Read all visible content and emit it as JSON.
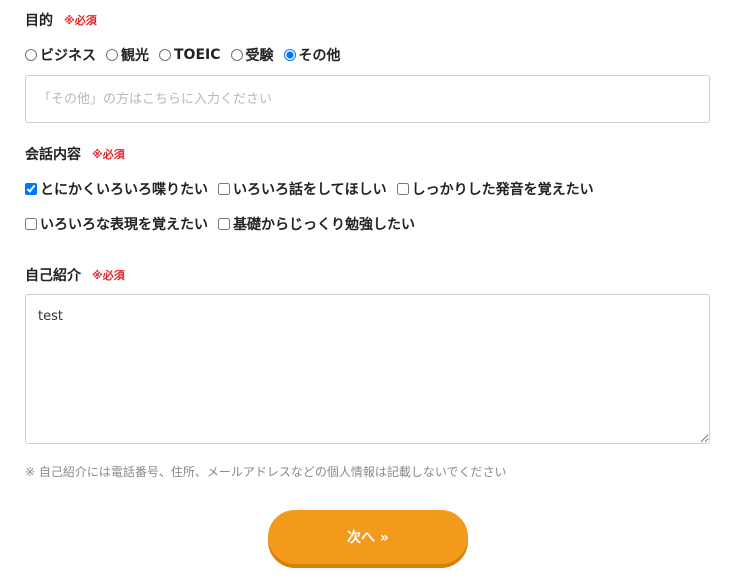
{
  "purpose": {
    "label": "目的",
    "required": "※必須",
    "options": [
      "ビジネス",
      "観光",
      "TOEIC",
      "受験",
      "その他"
    ],
    "selected": "その他",
    "other_placeholder": "「その他」の方はこちらに入力ください"
  },
  "conversation": {
    "label": "会話内容",
    "required": "※必須",
    "options": [
      {
        "label": "とにかくいろいろ喋りたい",
        "checked": true
      },
      {
        "label": "いろいろ話をしてほしい",
        "checked": false
      },
      {
        "label": "しっかりした発音を覚えたい",
        "checked": false
      },
      {
        "label": "いろいろな表現を覚えたい",
        "checked": false
      },
      {
        "label": "基礎からじっくり勉強したい",
        "checked": false
      }
    ]
  },
  "intro": {
    "label": "自己紹介",
    "required": "※必須",
    "value": "test",
    "note": "※ 自己紹介には電話番号、住所、メールアドレスなどの個人情報は記載しないでください"
  },
  "next_button": {
    "label": "次へ »"
  },
  "colors": {
    "required": "#e0292f",
    "button": "#f39a1c",
    "note": "#8a8a8a"
  }
}
